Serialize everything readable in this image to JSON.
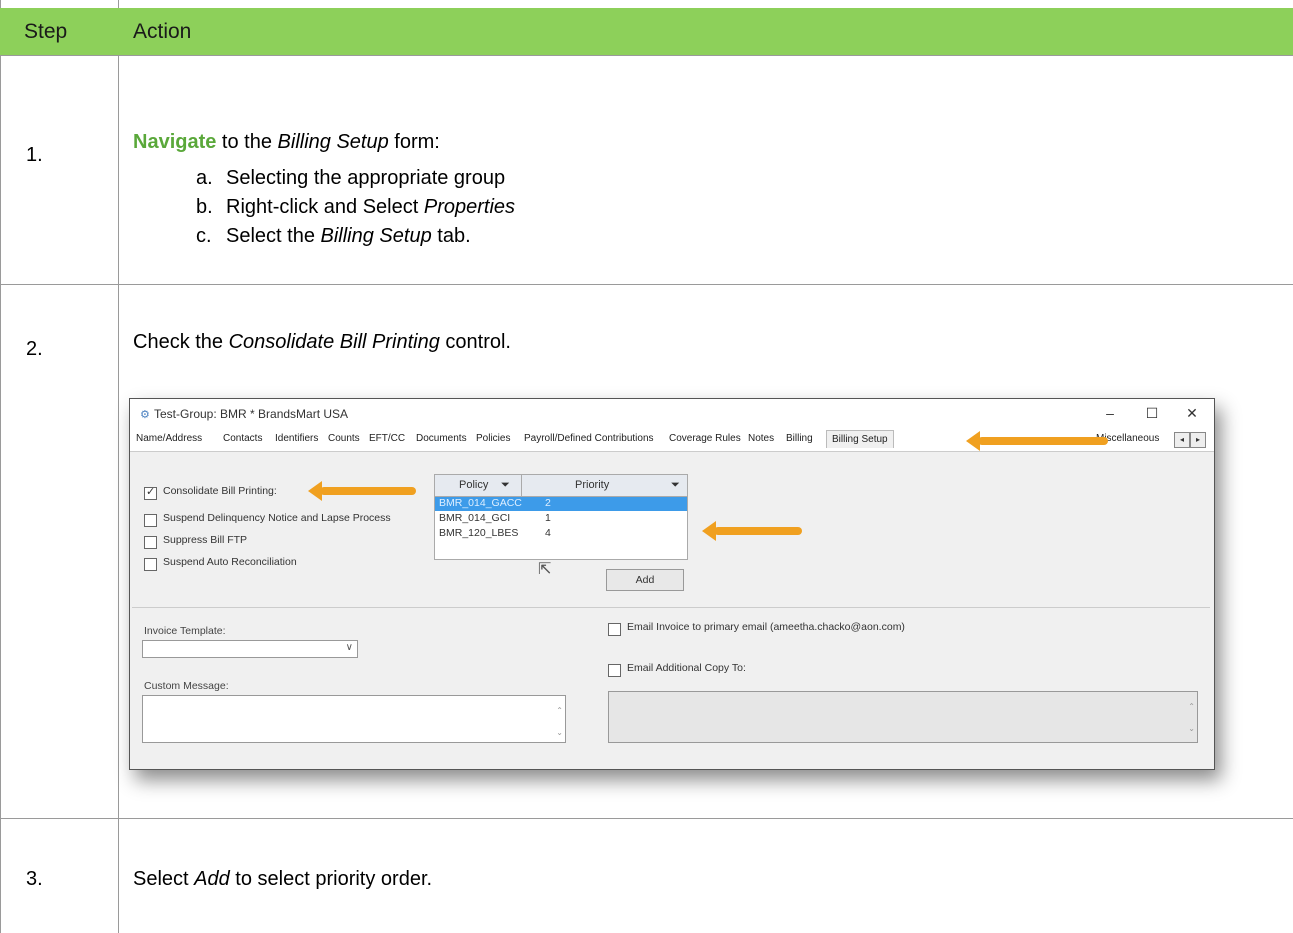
{
  "table": {
    "header": {
      "step": "Step",
      "action": "Action"
    },
    "header_color": "#8dd05a",
    "rows": [
      {
        "num": "1.",
        "lead_link": "Navigate",
        "lead_rest_a": " to the ",
        "lead_italic": "Billing Setup",
        "lead_rest_b": " form:",
        "subs": [
          {
            "label": "a.",
            "text_a": "Selecting the appropriate group",
            "italic": "",
            "text_b": ""
          },
          {
            "label": "b.",
            "text_a": "Right-click and Select ",
            "italic": "Properties",
            "text_b": ""
          },
          {
            "label": "c.",
            "text_a": "Select the ",
            "italic": "Billing Setup",
            "text_b": " tab."
          }
        ]
      },
      {
        "num": "2.",
        "text_a": "Check the ",
        "italic": "Consolidate Bill Printing",
        "text_b": " control."
      },
      {
        "num": "3.",
        "text_a": "Select ",
        "italic": "Add",
        "text_b": " to select priority order."
      }
    ]
  },
  "screenshot": {
    "window_title": "Test-Group: BMR * BrandsMart USA",
    "window_buttons": [
      "–",
      "☐",
      "✕"
    ],
    "tabs": [
      "Name/Address",
      "Contacts",
      "Identifiers",
      "Counts",
      "EFT/CC",
      "Documents",
      "Policies",
      "Payroll/Defined Contributions",
      "Coverage Rules",
      "Notes",
      "Billing",
      "Billing Setup",
      "Miscellaneous"
    ],
    "active_tab": "Billing Setup",
    "checkboxes": [
      {
        "label": "Consolidate Bill Printing:",
        "checked": true
      },
      {
        "label": "Suspend Delinquency Notice and Lapse Process",
        "checked": false
      },
      {
        "label": "Suppress Bill FTP",
        "checked": false
      },
      {
        "label": "Suspend Auto Reconciliation",
        "checked": false
      }
    ],
    "grid": {
      "columns": [
        "Policy",
        "Priority"
      ],
      "rows": [
        {
          "policy": "BMR_014_GACC",
          "priority": "2"
        },
        {
          "policy": "BMR_014_GCI",
          "priority": "1"
        },
        {
          "policy": "BMR_120_LBES",
          "priority": "4"
        }
      ],
      "selected_index": 0
    },
    "add_button": "Add",
    "invoice_template_label": "Invoice Template:",
    "custom_message_label": "Custom Message:",
    "email_invoice_label": "Email Invoice to primary email  (ameetha.chacko@aon.com)",
    "email_additional_label": "Email Additional Copy To:",
    "annotation_color": "#f0a020"
  }
}
